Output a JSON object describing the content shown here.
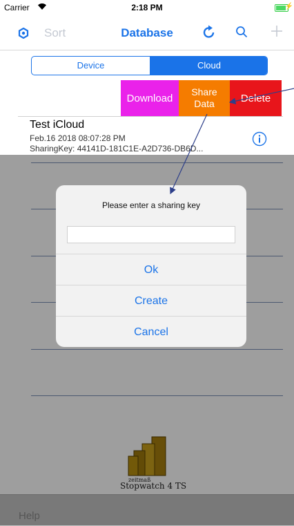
{
  "status_bar": {
    "carrier": "Carrier",
    "time": "2:18 PM"
  },
  "nav": {
    "sort_label": "Sort",
    "title": "Database"
  },
  "segments": {
    "device": "Device",
    "cloud": "Cloud",
    "selected": "Cloud"
  },
  "swipe_actions": {
    "download": "Download",
    "share_line1": "Share",
    "share_line2": "Data",
    "delete": "Delete"
  },
  "row": {
    "title": "Test iCloud",
    "date": "Feb.16 2018 08:07:28 PM",
    "sharing_key": "SharingKey: 44141D-181C1E-A2D736-DB6D..."
  },
  "dialog": {
    "title": "Please enter a sharing key",
    "input_value": "",
    "ok": "Ok",
    "create": "Create",
    "cancel": "Cancel"
  },
  "logo": {
    "small_text": "zeitmaß",
    "name": "Stopwatch 4 TS"
  },
  "bottom": {
    "help": "Help"
  },
  "colors": {
    "accent": "#1a73e8",
    "download": "#ea22ea",
    "share": "#f57c00",
    "delete": "#e8151b"
  },
  "icons": [
    "wifi-icon",
    "battery-icon",
    "settings-icon",
    "refresh-icon",
    "search-icon",
    "plus-icon",
    "info-icon",
    "logo-icon"
  ]
}
